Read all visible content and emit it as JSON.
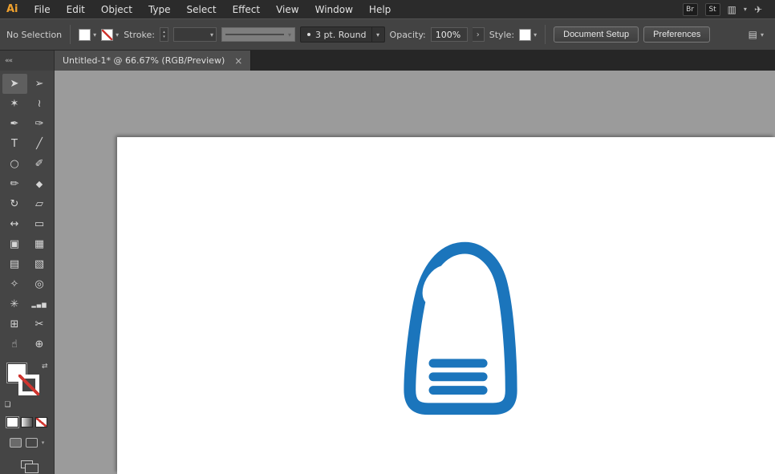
{
  "menu_bar": {
    "logo": "Ai",
    "items": [
      "File",
      "Edit",
      "Object",
      "Type",
      "Select",
      "Effect",
      "View",
      "Window",
      "Help"
    ],
    "bridge_label": "Br",
    "stock_label": "St"
  },
  "control_bar": {
    "selection_status": "No Selection",
    "stroke_label": "Stroke:",
    "brush_bullet": "•",
    "brush_name": "3 pt. Round",
    "opacity_label": "Opacity:",
    "opacity_value": "100%",
    "style_label": "Style:",
    "document_setup_label": "Document Setup",
    "preferences_label": "Preferences"
  },
  "tab": {
    "title": "Untitled-1* @ 66.67% (RGB/Preview)",
    "close_glyph": "×"
  },
  "glyphs": {
    "chevron_down": "▾",
    "chevron_up": "▴",
    "flyout_right": "›",
    "collapse": "««",
    "swap": "⇄",
    "mini_defaults": "❏",
    "arrange_documents": "▥",
    "rocket": "✈",
    "panel_options": "▤"
  },
  "toolbar": {
    "tools": [
      {
        "name": "selection-tool",
        "glyph": "➤"
      },
      {
        "name": "direct-selection-tool",
        "glyph": "➢"
      },
      {
        "name": "magic-wand-tool",
        "glyph": "✶"
      },
      {
        "name": "lasso-tool",
        "glyph": "≀"
      },
      {
        "name": "pen-tool",
        "glyph": "✒"
      },
      {
        "name": "curvature-tool",
        "glyph": "✑"
      },
      {
        "name": "type-tool",
        "glyph": "T"
      },
      {
        "name": "line-segment-tool",
        "glyph": "╱"
      },
      {
        "name": "ellipse-tool",
        "glyph": "○"
      },
      {
        "name": "paintbrush-tool",
        "glyph": "✐"
      },
      {
        "name": "pencil-tool",
        "glyph": "✏"
      },
      {
        "name": "eraser-tool",
        "glyph": "◆"
      },
      {
        "name": "rotate-tool",
        "glyph": "↻"
      },
      {
        "name": "scale-tool",
        "glyph": "▱"
      },
      {
        "name": "width-tool",
        "glyph": "↔"
      },
      {
        "name": "free-transform-tool",
        "glyph": "▭"
      },
      {
        "name": "shape-builder-tool",
        "glyph": "▣"
      },
      {
        "name": "perspective-grid-tool",
        "glyph": "▦"
      },
      {
        "name": "mesh-tool",
        "glyph": "▤"
      },
      {
        "name": "gradient-tool",
        "glyph": "▧"
      },
      {
        "name": "eyedropper-tool",
        "glyph": "✧"
      },
      {
        "name": "blend-tool",
        "glyph": "◎"
      },
      {
        "name": "symbol-sprayer-tool",
        "glyph": "✳"
      },
      {
        "name": "column-graph-tool",
        "glyph": "▂▄▆"
      },
      {
        "name": "artboard-tool",
        "glyph": "⊞"
      },
      {
        "name": "slice-tool",
        "glyph": "✂"
      },
      {
        "name": "hand-tool",
        "glyph": "☝"
      },
      {
        "name": "zoom-tool",
        "glyph": "⊕"
      }
    ]
  },
  "colors": {
    "accent_blue": "#1b75bc",
    "none_red": "#cf3630",
    "canvas_background": "#9b9b9b",
    "artboard": "#ffffff"
  },
  "artwork": {
    "description": "blue bottle logo with tilted white ellipse highlight and three horizontal label bars",
    "bar_count": 3
  }
}
